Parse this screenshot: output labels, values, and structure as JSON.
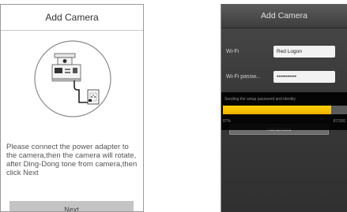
{
  "left_screen": {
    "title": "Add Camera",
    "instructions": "Please connect the power adapter to the camera,then the camera will rotate, after Ding-Dong tone from camera,then click Next",
    "next_label": "Next"
  },
  "right_screen": {
    "title": "Add Camera",
    "wifi_label": "Wi-Fi",
    "wifi_value": "Red Logon",
    "password_label": "Wi-Fi passw...",
    "password_value": "•••••••••••",
    "advanced_label": "Advanced",
    "progress": {
      "message": "Sending the setup password and identity",
      "percent_label": "87%",
      "count_label": "87/100",
      "fraction": 0.87
    }
  },
  "colors": {
    "progress_fill": "#f5c400",
    "dark_background": "#3a3a3a",
    "button_gray": "#c4c4c4"
  }
}
